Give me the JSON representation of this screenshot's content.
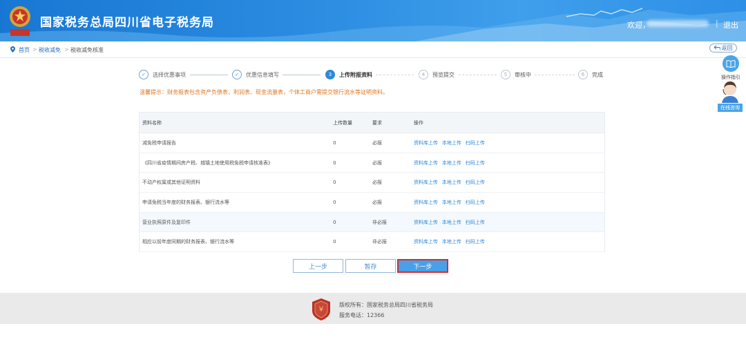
{
  "header": {
    "emblem_text": "中国税务",
    "title": "国家税务总局四川省电子税务局",
    "welcome": "欢迎，",
    "separator": "|",
    "logout": "退出"
  },
  "breadcrumb": {
    "home": "首页",
    "item1": "税收减免",
    "item2": "税收减免核准",
    "gt": ">"
  },
  "back_label": "返回",
  "side": {
    "guide": "操作指引",
    "online": "在线咨询"
  },
  "steps": [
    {
      "num": "1",
      "label": "选择优惠事项",
      "state": "done"
    },
    {
      "num": "2",
      "label": "优惠信息填写",
      "state": "done"
    },
    {
      "num": "3",
      "label": "上传附报资料",
      "state": "active"
    },
    {
      "num": "4",
      "label": "预览提交",
      "state": "todo"
    },
    {
      "num": "5",
      "label": "审核中",
      "state": "todo"
    },
    {
      "num": "6",
      "label": "完成",
      "state": "todo"
    }
  ],
  "tip": "温馨提示：财务报表包含资产负债表、利润表、现金流量表，个体工商户需提交银行流水等证明资料。",
  "table": {
    "headers": [
      "资料名称",
      "上传数量",
      "要求",
      "操作"
    ],
    "ops": [
      "资料库上传",
      "本地上传",
      "扫码上传"
    ],
    "rows": [
      {
        "name": "减免税申请报告",
        "count": "0",
        "req": "必报"
      },
      {
        "name": "《四川省疫情期间房产税、城镇土地使用税免税申请核准表》",
        "count": "0",
        "req": "必报"
      },
      {
        "name": "不动产权属或其他证明资料",
        "count": "0",
        "req": "必报"
      },
      {
        "name": "申请免税当年度的财务报表、银行流水等",
        "count": "0",
        "req": "必报"
      },
      {
        "name": "营业执照原件及复印件",
        "count": "0",
        "req": "非必报"
      },
      {
        "name": "相应以前年度同期的财务报表、银行流水等",
        "count": "0",
        "req": "非必报"
      }
    ]
  },
  "buttons": {
    "prev": "上一步",
    "save": "暂存",
    "next": "下一步"
  },
  "footer": {
    "copyright": "版权所有：国家税务总局四川省税务局",
    "phone": "服务电话：12366"
  }
}
